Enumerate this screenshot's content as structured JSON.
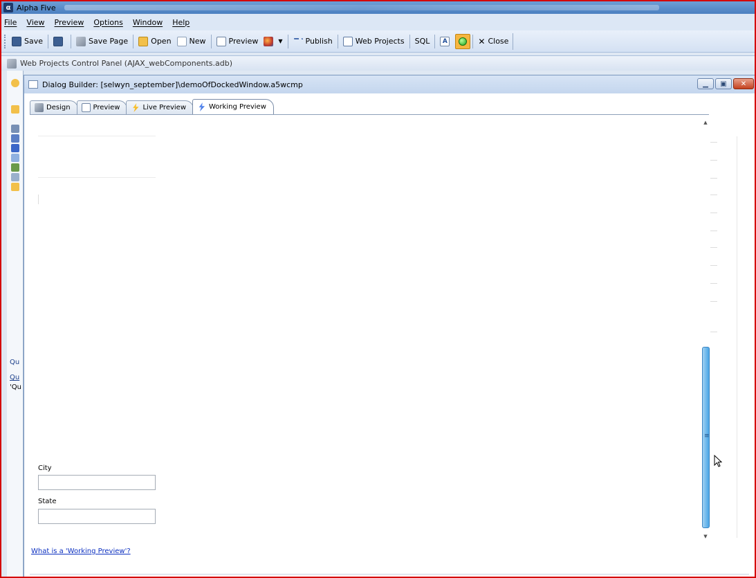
{
  "app": {
    "title": "Alpha Five",
    "logo": "α"
  },
  "menu": {
    "items": [
      "File",
      "View",
      "Preview",
      "Options",
      "Window",
      "Help"
    ]
  },
  "toolbar": {
    "save": "Save",
    "save_page": "Save Page",
    "open": "Open",
    "new": "New",
    "preview": "Preview",
    "publish": "Publish",
    "web_projects": "Web Projects",
    "sql": "SQL",
    "close": "Close"
  },
  "web_projects_panel": {
    "title": "Web Projects Control Panel (AJAX_webComponents.adb)"
  },
  "dialog_builder": {
    "title": "Dialog Builder: [selwyn_september]\\demoOfDockedWindow.a5wcmp",
    "tabs": [
      {
        "label": "Design",
        "icon": "design-icon"
      },
      {
        "label": "Preview",
        "icon": "preview-icon"
      },
      {
        "label": "Live Preview",
        "icon": "live-preview-icon"
      },
      {
        "label": "Working Preview",
        "icon": "working-preview-icon",
        "active": true
      }
    ],
    "fields": [
      {
        "label": "City",
        "value": ""
      },
      {
        "label": "State",
        "value": ""
      }
    ],
    "help_link": "What is a 'Working Preview'?"
  },
  "colors": {
    "frame_border": "#d40000",
    "scroll_thumb": "#4aa6e6",
    "link": "#0b2fc0"
  }
}
